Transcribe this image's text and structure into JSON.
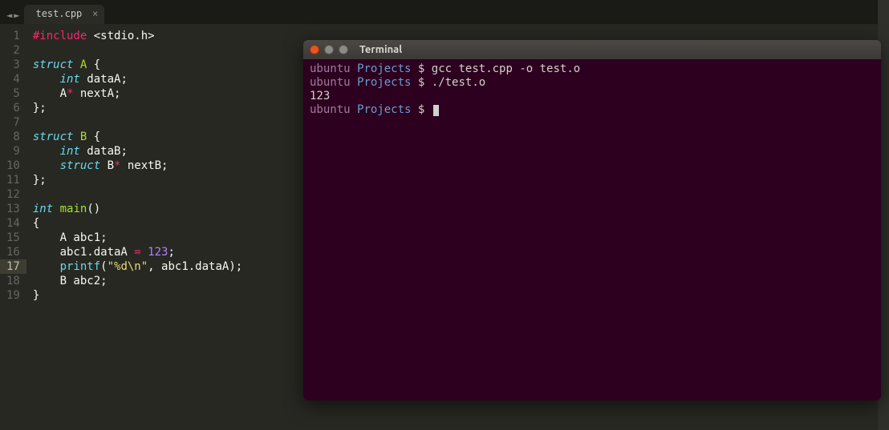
{
  "editor": {
    "tab": {
      "label": "test.cpp"
    },
    "highlighted_line": 17,
    "lines": [
      {
        "n": 1,
        "tokens": [
          [
            "kw-pre",
            "#include"
          ],
          [
            "plain",
            " "
          ],
          [
            "punct",
            "<stdio.h>"
          ]
        ]
      },
      {
        "n": 2,
        "tokens": []
      },
      {
        "n": 3,
        "tokens": [
          [
            "kw-blue",
            "struct"
          ],
          [
            "plain",
            " "
          ],
          [
            "fn",
            "A"
          ],
          [
            "plain",
            " "
          ],
          [
            "punct",
            "{"
          ]
        ]
      },
      {
        "n": 4,
        "tokens": [
          [
            "plain",
            "    "
          ],
          [
            "kw-blue",
            "int"
          ],
          [
            "plain",
            " dataA"
          ],
          [
            "punct",
            ";"
          ]
        ]
      },
      {
        "n": 5,
        "tokens": [
          [
            "plain",
            "    A"
          ],
          [
            "op",
            "*"
          ],
          [
            "plain",
            " nextA"
          ],
          [
            "punct",
            ";"
          ]
        ]
      },
      {
        "n": 6,
        "tokens": [
          [
            "punct",
            "};"
          ]
        ]
      },
      {
        "n": 7,
        "tokens": []
      },
      {
        "n": 8,
        "tokens": [
          [
            "kw-blue",
            "struct"
          ],
          [
            "plain",
            " "
          ],
          [
            "fn",
            "B"
          ],
          [
            "plain",
            " "
          ],
          [
            "punct",
            "{"
          ]
        ]
      },
      {
        "n": 9,
        "tokens": [
          [
            "plain",
            "    "
          ],
          [
            "kw-blue",
            "int"
          ],
          [
            "plain",
            " dataB"
          ],
          [
            "punct",
            ";"
          ]
        ]
      },
      {
        "n": 10,
        "tokens": [
          [
            "plain",
            "    "
          ],
          [
            "kw-blue",
            "struct"
          ],
          [
            "plain",
            " B"
          ],
          [
            "op",
            "*"
          ],
          [
            "plain",
            " nextB"
          ],
          [
            "punct",
            ";"
          ]
        ]
      },
      {
        "n": 11,
        "tokens": [
          [
            "punct",
            "};"
          ]
        ]
      },
      {
        "n": 12,
        "tokens": []
      },
      {
        "n": 13,
        "tokens": [
          [
            "kw-blue",
            "int"
          ],
          [
            "plain",
            " "
          ],
          [
            "fn",
            "main"
          ],
          [
            "punct",
            "()"
          ]
        ]
      },
      {
        "n": 14,
        "tokens": [
          [
            "punct",
            "{"
          ]
        ]
      },
      {
        "n": 15,
        "tokens": [
          [
            "plain",
            "    A abc1"
          ],
          [
            "punct",
            ";"
          ]
        ]
      },
      {
        "n": 16,
        "tokens": [
          [
            "plain",
            "    abc1.dataA "
          ],
          [
            "op",
            "="
          ],
          [
            "plain",
            " "
          ],
          [
            "num",
            "123"
          ],
          [
            "punct",
            ";"
          ]
        ]
      },
      {
        "n": 17,
        "tokens": [
          [
            "plain",
            "    "
          ],
          [
            "fn-call",
            "printf"
          ],
          [
            "punct",
            "("
          ],
          [
            "str",
            "\"%d\\n\""
          ],
          [
            "punct",
            ", abc1.dataA);"
          ]
        ]
      },
      {
        "n": 18,
        "tokens": [
          [
            "plain",
            "    B abc2"
          ],
          [
            "punct",
            ";"
          ]
        ]
      },
      {
        "n": 19,
        "tokens": [
          [
            "punct",
            "}"
          ]
        ]
      }
    ]
  },
  "terminal": {
    "title": "Terminal",
    "prompt": {
      "user": "ubuntu",
      "path": "Projects",
      "sep": "$"
    },
    "lines": [
      {
        "type": "cmd",
        "text": "gcc test.cpp -o test.o"
      },
      {
        "type": "cmd",
        "text": "./test.o"
      },
      {
        "type": "out",
        "text": "123"
      },
      {
        "type": "cmd",
        "text": "",
        "cursor": true
      }
    ]
  }
}
